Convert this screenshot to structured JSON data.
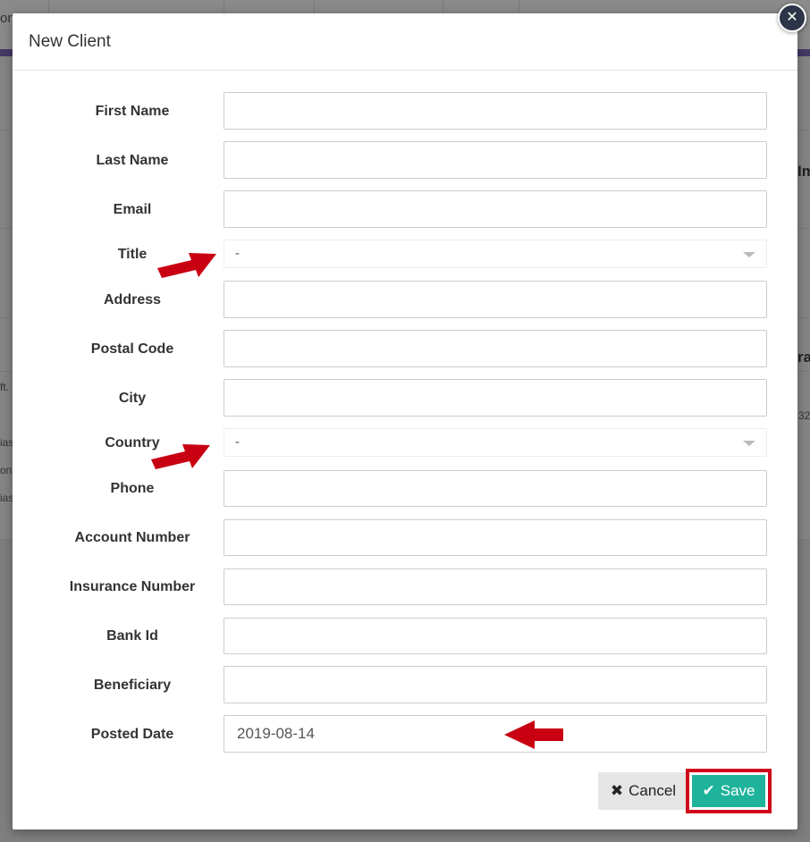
{
  "modal": {
    "title": "New Client",
    "close_icon": "close-icon",
    "fields": {
      "first_name": {
        "label": "First Name",
        "value": ""
      },
      "last_name": {
        "label": "Last Name",
        "value": ""
      },
      "email": {
        "label": "Email",
        "value": ""
      },
      "title": {
        "label": "Title",
        "value": "-"
      },
      "address": {
        "label": "Address",
        "value": ""
      },
      "postal_code": {
        "label": "Postal Code",
        "value": ""
      },
      "city": {
        "label": "City",
        "value": ""
      },
      "country": {
        "label": "Country",
        "value": "-"
      },
      "phone": {
        "label": "Phone",
        "value": ""
      },
      "account_number": {
        "label": "Account Number",
        "value": ""
      },
      "insurance_number": {
        "label": "Insurance Number",
        "value": ""
      },
      "bank_id": {
        "label": "Bank Id",
        "value": ""
      },
      "beneficiary": {
        "label": "Beneficiary",
        "value": ""
      },
      "posted_date": {
        "label": "Posted Date",
        "value": "2019-08-14"
      }
    },
    "buttons": {
      "cancel": "Cancel",
      "save": "Save"
    }
  },
  "background": {
    "frag_1": "on",
    "frag_2": "Im",
    "frag_3": "ra",
    "frag_4": "ft.",
    "frag_5": "32",
    "frag_6": "ias",
    "frag_7": "on",
    "frag_8": "ias"
  },
  "colors": {
    "accent_purple": "#453866",
    "save_green": "#1fb39b",
    "highlight_red": "#d0021b"
  }
}
